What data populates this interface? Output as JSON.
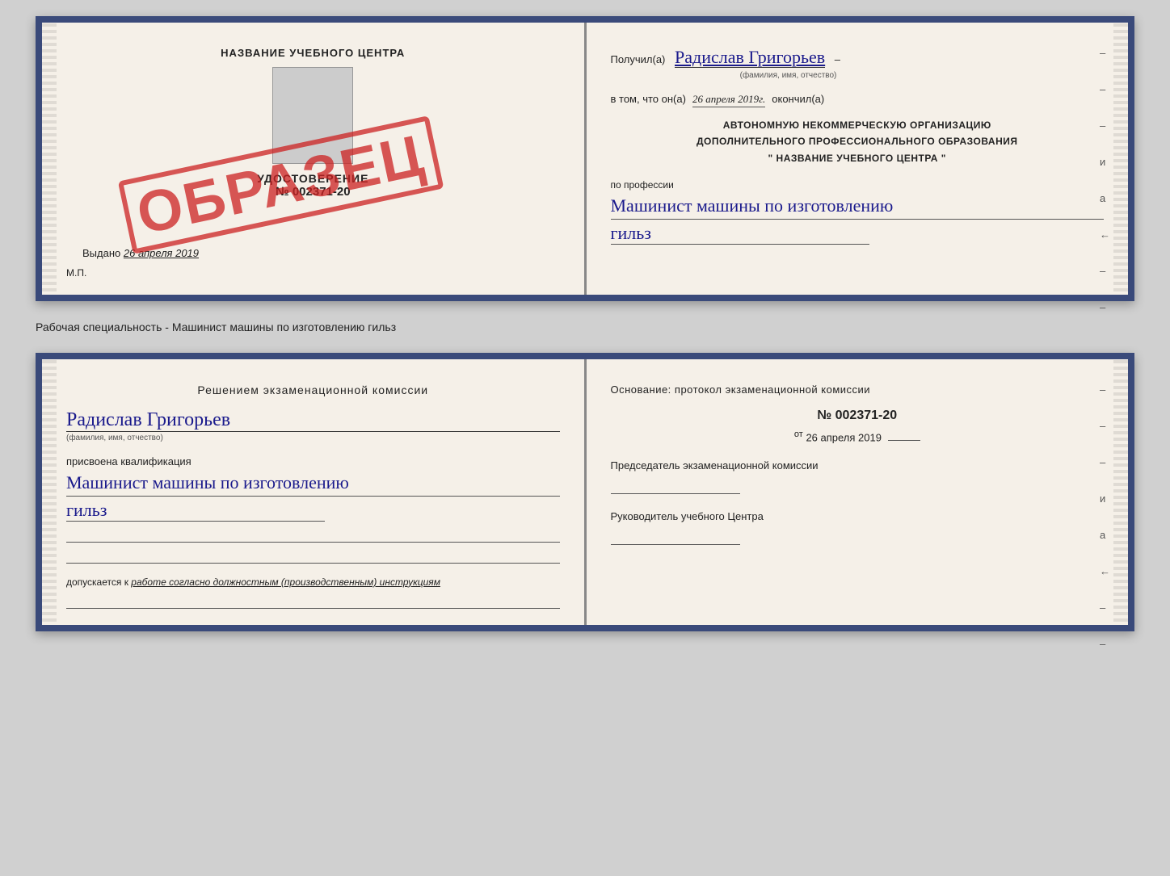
{
  "top_document": {
    "left": {
      "center_name": "НАЗВАНИЕ УЧЕБНОГО ЦЕНТРА",
      "certificate_label": "УДОСТОВЕРЕНИЕ",
      "certificate_number": "№ 002371-20",
      "stamp_text": "ОБРАЗЕЦ",
      "issued_prefix": "Выдано",
      "issued_date": "26 апреля 2019",
      "mp_label": "М.П."
    },
    "right": {
      "received_prefix": "Получил(а)",
      "received_name": "Радислав Григорьев",
      "received_sub": "(фамилия, имя, отчество)",
      "dash": "–",
      "completed_prefix": "в том, что он(а)",
      "completed_date": "26 апреля 2019г.",
      "completed_suffix": "окончил(а)",
      "org_line1": "АВТОНОМНУЮ НЕКОММЕРЧЕСКУЮ ОРГАНИЗАЦИЮ",
      "org_line2": "ДОПОЛНИТЕЛЬНОГО ПРОФЕССИОНАЛЬНОГО ОБРАЗОВАНИЯ",
      "org_line3": "\"   НАЗВАНИЕ УЧЕБНОГО ЦЕНТРА   \"",
      "profession_label": "по профессии",
      "profession_value": "Машинист машины по изготовлению",
      "profession_value2": "гильз",
      "side_dashes": [
        "–",
        "–",
        "–",
        "и",
        "а",
        "←",
        "–",
        "–"
      ]
    }
  },
  "middle": {
    "text": "Рабочая специальность - Машинист машины по изготовлению гильз"
  },
  "bottom_document": {
    "left": {
      "decision_title": "Решением  экзаменационной  комиссии",
      "person_name": "Радислав Григорьев",
      "person_sub": "(фамилия, имя, отчество)",
      "qualification_prefix": "присвоена квалификация",
      "qualification_value": "Машинист машины по изготовлению",
      "qualification_value2": "гильз",
      "allowed_prefix": "допускается к",
      "allowed_value": "работе согласно должностным (производственным) инструкциям"
    },
    "right": {
      "basis_title": "Основание: протокол экзаменационной  комиссии",
      "protocol_number": "№  002371-20",
      "protocol_date_prefix": "от",
      "protocol_date": "26 апреля 2019",
      "commission_chair_label": "Председатель экзаменационной комиссии",
      "head_label": "Руководитель учебного Центра",
      "side_dashes": [
        "–",
        "–",
        "–",
        "и",
        "а",
        "←",
        "–",
        "–"
      ]
    }
  }
}
